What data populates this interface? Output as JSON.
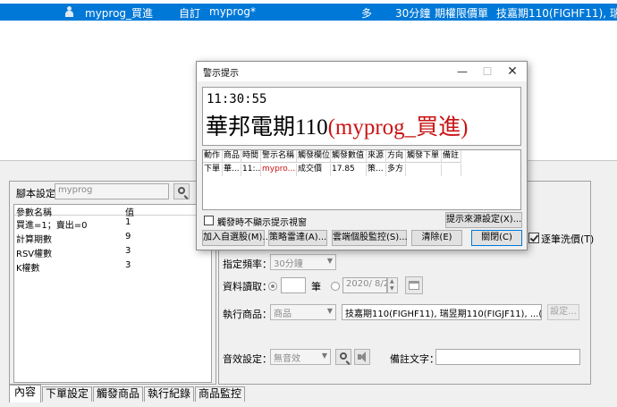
{
  "strategy_row": {
    "name": "myprog_買進",
    "type": "自訂",
    "program": "myprog*",
    "direction": "多",
    "frequency": "30分鐘",
    "order_type": "期權限價單",
    "products": "技嘉期110(FIGHF11), 瑞昱"
  },
  "script_panel": {
    "label": "腳本設定",
    "value": "myprog",
    "param_headers": [
      "參數名稱",
      "值"
    ],
    "params": [
      {
        "name": "買進=1；賣出=0",
        "value": "1"
      },
      {
        "name": "計算期數",
        "value": "9"
      },
      {
        "name": "RSV權數",
        "value": "3"
      },
      {
        "name": "K權數",
        "value": "3"
      }
    ]
  },
  "settings": {
    "clean_price_label": "逐筆洗價(T)",
    "clean_price_checked": true,
    "freq_label": "指定頻率：",
    "freq_value": "30分鐘",
    "data_read_label": "資料讀取：",
    "data_unit": "筆",
    "data_date": "2020/ 8/20",
    "exec_label": "執行商品：",
    "exec_combo": "商品",
    "exec_value": "技嘉期110(FIGHF11), 瑞昱期110(FIGJF11), ...(共 5項)",
    "settings_button": "設定...",
    "sound_label": "音效設定：",
    "sound_value": "無音效",
    "memo_label": "備註文字："
  },
  "tabs": [
    "內容",
    "下單設定",
    "觸發商品",
    "執行紀錄",
    "商品監控"
  ],
  "dialog": {
    "title": "警示提示",
    "time": "11:30:55",
    "headline_product": "華邦電期110",
    "headline_strategy": "(myprog_買進)",
    "columns": [
      "動作",
      "商品",
      "時間",
      "警示名稱",
      "觸發欄位",
      "觸發數值",
      "來源",
      "方向",
      "觸發下單",
      "備註"
    ],
    "row": [
      "下單",
      "華...",
      "11:...",
      "mypro...",
      "成交價",
      "17.85",
      "策...",
      "多方",
      "",
      ""
    ],
    "hide_checkbox_label": "觸發時不顯示提示視窗",
    "buttons": {
      "source_settings": "提示來源設定(X)...",
      "add_watch": "加入自選股(M)...",
      "radar": "策略雷達(A)...",
      "cloud": "雲端個股監控(S)...",
      "clear": "清除(E)",
      "close": "關閉(C)"
    }
  },
  "colors": {
    "selection": "#0078d7",
    "headline_red": "#c81414",
    "dialog_bg": "#f0f0f0"
  }
}
